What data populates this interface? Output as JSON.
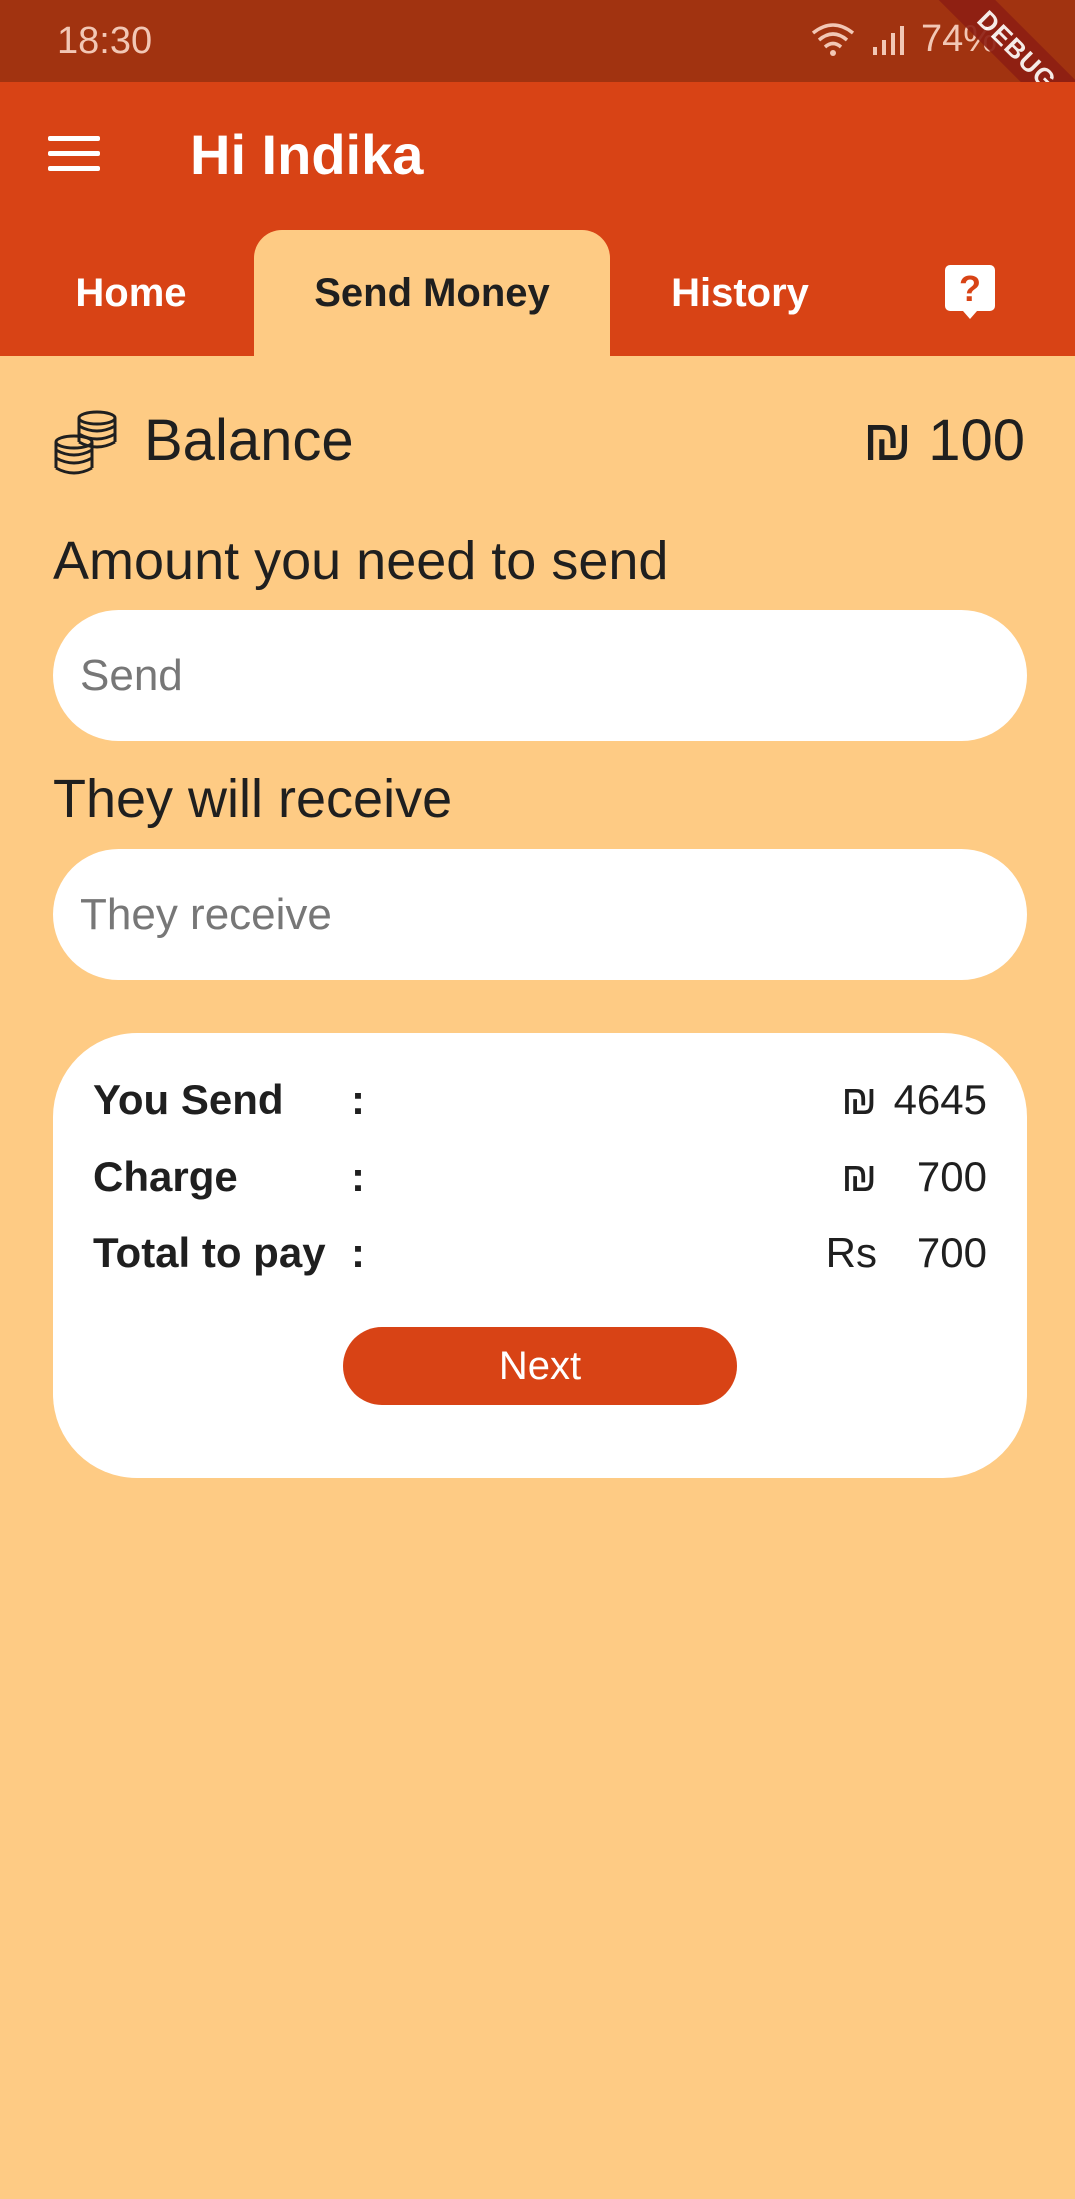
{
  "status_bar": {
    "time": "18:30",
    "battery": "74%"
  },
  "debug_banner": "DEBUG",
  "app_bar": {
    "title": "Hi Indika"
  },
  "tabs": [
    {
      "label": "Home",
      "active": false
    },
    {
      "label": "Send Money",
      "active": true
    },
    {
      "label": "History",
      "active": false
    }
  ],
  "balance": {
    "label": "Balance",
    "currency": "₪",
    "amount": "100"
  },
  "send_field": {
    "label": "Amount you need to send",
    "placeholder": "Send",
    "value": ""
  },
  "receive_field": {
    "label": "They will receive",
    "placeholder": "They receive",
    "value": ""
  },
  "summary": {
    "rows": [
      {
        "label": "You Send",
        "colon": ":",
        "currency": "₪",
        "value": "4645"
      },
      {
        "label": "Charge",
        "colon": ":",
        "currency": "₪",
        "value": "700"
      },
      {
        "label": "Total to pay",
        "colon": ":",
        "currency": "Rs",
        "value": "700"
      }
    ],
    "next_label": "Next"
  },
  "colors": {
    "status_bar": "#A13310",
    "app_bar": "#D84315",
    "background": "#FECB84",
    "accent": "#D84315",
    "card": "#FFFFFF"
  }
}
